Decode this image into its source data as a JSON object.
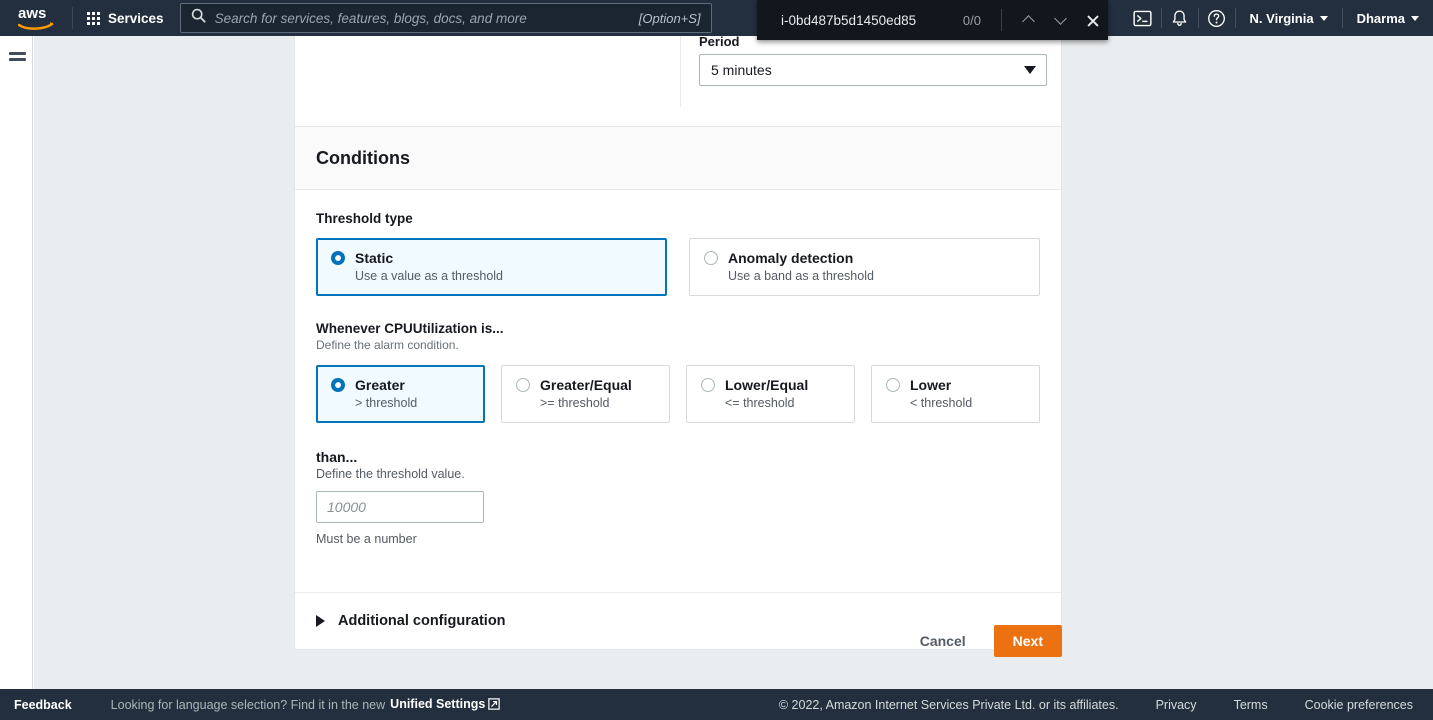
{
  "topnav": {
    "logo_icon": "aws-logo",
    "apps_icon": "grid-apps-icon",
    "services_label": "Services",
    "search": {
      "icon": "search-icon",
      "placeholder": "Search for services, features, blogs, docs, and more",
      "value": "",
      "shortcut": "[Option+S]"
    },
    "cloudshell_icon": "cloudshell-terminal-icon",
    "notifications_icon": "bell-icon",
    "help_icon": "question-circle-icon",
    "region_label": "N. Virginia",
    "account_label": "Dharma"
  },
  "findbar": {
    "query": "i-0bd487b5d1450ed85",
    "match_count": "0/0",
    "prev_icon": "chevron-up-icon",
    "next_icon": "chevron-down-icon",
    "close_icon": "close-icon"
  },
  "sidebar": {
    "menu_icon": "hamburger-menu-icon"
  },
  "metric_panel": {
    "period_label": "Period",
    "period_value": "5 minutes",
    "dropdown_icon": "caret-down-icon"
  },
  "conditions": {
    "title": "Conditions",
    "threshold_type": {
      "label": "Threshold type",
      "options": [
        {
          "title": "Static",
          "subtitle": "Use a value as a threshold",
          "selected": true
        },
        {
          "title": "Anomaly detection",
          "subtitle": "Use a band as a threshold",
          "selected": false
        }
      ]
    },
    "comparison": {
      "label": "Whenever CPUUtilization is...",
      "hint": "Define the alarm condition.",
      "options": [
        {
          "title": "Greater",
          "subtitle": "> threshold",
          "selected": true
        },
        {
          "title": "Greater/Equal",
          "subtitle": ">= threshold",
          "selected": false
        },
        {
          "title": "Lower/Equal",
          "subtitle": "<= threshold",
          "selected": false
        },
        {
          "title": "Lower",
          "subtitle": "< threshold",
          "selected": false
        }
      ]
    },
    "threshold_value": {
      "label": "than...",
      "hint": "Define the threshold value.",
      "placeholder": "10000",
      "value": "",
      "constraint": "Must be a number"
    },
    "additional_configuration": {
      "label": "Additional configuration",
      "expand_icon": "triangle-right-icon",
      "expanded": false
    }
  },
  "actions": {
    "cancel_label": "Cancel",
    "next_label": "Next"
  },
  "footer": {
    "feedback_label": "Feedback",
    "language_text": "Looking for language selection? Find it in the new",
    "unified_settings_label": "Unified Settings",
    "external_icon": "external-link-icon",
    "copyright": "© 2022, Amazon Internet Services Private Ltd. or its affiliates.",
    "privacy_label": "Privacy",
    "terms_label": "Terms",
    "cookie_label": "Cookie preferences"
  },
  "colors": {
    "nav_bg": "#232f3e",
    "accent_orange": "#ec7211",
    "accent_blue": "#0073bb",
    "selected_card_bg": "#f1faff",
    "canvas_bg": "#eaedef"
  }
}
